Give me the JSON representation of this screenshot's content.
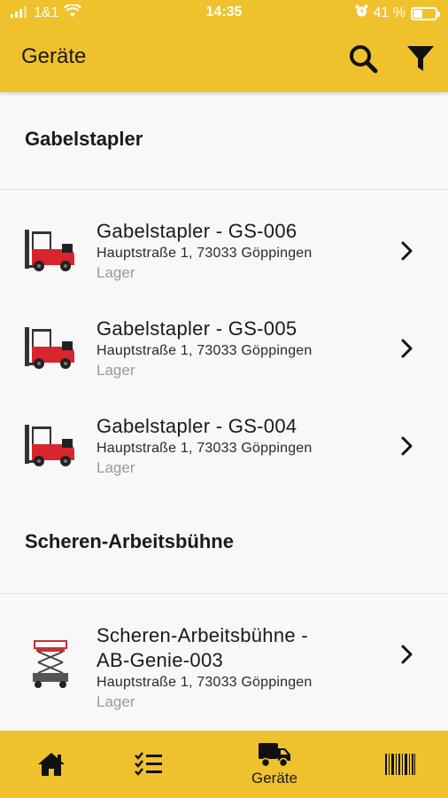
{
  "status_bar": {
    "carrier": "1&1",
    "time": "14:35",
    "battery_percent": "41 %",
    "battery_level": 0.41
  },
  "header": {
    "title": "Geräte"
  },
  "sections": [
    {
      "title": "Gabelstapler",
      "items": [
        {
          "title": "Gabelstapler - GS-006",
          "address": "Hauptstraße 1, 73033 Göppingen",
          "location": "Lager"
        },
        {
          "title": "Gabelstapler - GS-005",
          "address": "Hauptstraße 1, 73033 Göppingen",
          "location": "Lager"
        },
        {
          "title": "Gabelstapler - GS-004",
          "address": "Hauptstraße 1, 73033 Göppingen",
          "location": "Lager"
        }
      ]
    },
    {
      "title": "Scheren-Arbeitsbühne",
      "items": [
        {
          "title_line1": "Scheren-Arbeitsbühne -",
          "title_line2": "AB-Genie-003",
          "address": "Hauptstraße 1, 73033 Göppingen",
          "location": "Lager"
        }
      ]
    }
  ],
  "bottom_nav": {
    "items": [
      {
        "icon": "home-icon",
        "label": ""
      },
      {
        "icon": "checklist-icon",
        "label": ""
      },
      {
        "icon": "truck-icon",
        "label": "Geräte",
        "active": true
      },
      {
        "icon": "barcode-icon",
        "label": ""
      }
    ]
  },
  "colors": {
    "accent": "#efc22d",
    "background": "#f8f8f8",
    "text": "#1a1a1a",
    "muted": "#9a9a9a",
    "forklift_red": "#d9252e"
  }
}
